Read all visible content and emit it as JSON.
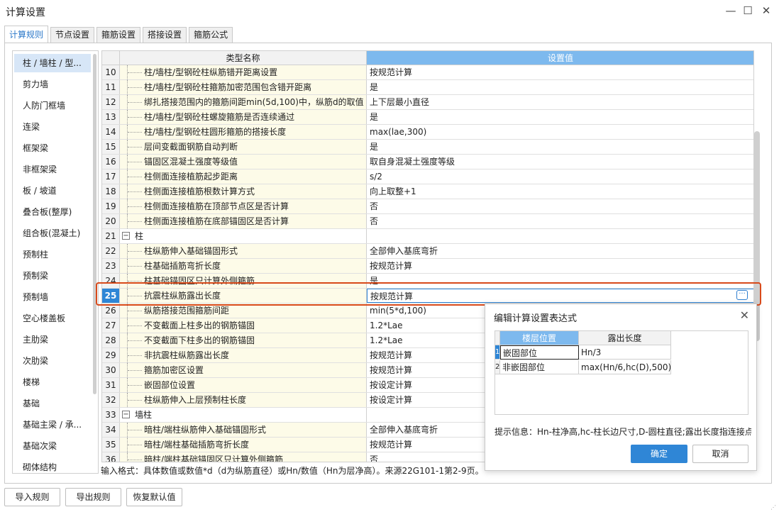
{
  "window": {
    "title": "计算设置"
  },
  "tabs": [
    {
      "label": "计算规则",
      "active": true
    },
    {
      "label": "节点设置",
      "active": false
    },
    {
      "label": "箍筋设置",
      "active": false
    },
    {
      "label": "搭接设置",
      "active": false
    },
    {
      "label": "箍筋公式",
      "active": false
    }
  ],
  "sidebar": {
    "items": [
      "柱 / 墙柱 / 型...",
      "剪力墙",
      "人防门框墙",
      "连梁",
      "框架梁",
      "非框架梁",
      "板 / 坡道",
      "叠合板(整厚)",
      "组合板(混凝土)",
      "预制柱",
      "预制梁",
      "预制墙",
      "空心楼盖板",
      "主肋梁",
      "次肋梁",
      "楼梯",
      "基础",
      "基础主梁 / 承...",
      "基础次梁",
      "砌体结构"
    ],
    "selected_index": 0
  },
  "grid": {
    "columns": [
      "类型名称",
      "设置值"
    ],
    "rows": [
      {
        "no": "10",
        "name": "柱/墙柱/型钢砼柱纵筋错开距离设置",
        "value": "按规范计算"
      },
      {
        "no": "11",
        "name": "柱/墙柱/型钢砼柱箍筋加密范围包含错开距离",
        "value": "是"
      },
      {
        "no": "12",
        "name": "绑扎搭接范围内的箍筋间距min(5d,100)中，纵筋d的取值",
        "value": "上下层最小直径"
      },
      {
        "no": "13",
        "name": "柱/墙柱/型钢砼柱螺旋箍筋是否连续通过",
        "value": "是"
      },
      {
        "no": "14",
        "name": "柱/墙柱/型钢砼柱圆形箍筋的搭接长度",
        "value": "max(lae,300)"
      },
      {
        "no": "15",
        "name": "层间变截面钢筋自动判断",
        "value": "是"
      },
      {
        "no": "16",
        "name": "锚固区混凝土强度等级值",
        "value": "取自身混凝土强度等级"
      },
      {
        "no": "17",
        "name": "柱侧面连接植筋起步距离",
        "value": "s/2"
      },
      {
        "no": "18",
        "name": "柱侧面连接植筋根数计算方式",
        "value": "向上取整+1"
      },
      {
        "no": "19",
        "name": "柱侧面连接植筋在顶部节点区是否计算",
        "value": "否"
      },
      {
        "no": "20",
        "name": "柱侧面连接植筋在底部锚固区是否计算",
        "value": "否"
      },
      {
        "no": "21",
        "name": "柱",
        "value": "",
        "group": true
      },
      {
        "no": "22",
        "name": "柱纵筋伸入基础锚固形式",
        "value": "全部伸入基底弯折"
      },
      {
        "no": "23",
        "name": "柱基础插筋弯折长度",
        "value": "按规范计算"
      },
      {
        "no": "24",
        "name": "柱基础锚固区只计算外侧箍筋",
        "value": "是"
      },
      {
        "no": "25",
        "name": "抗震柱纵筋露出长度",
        "value": "按规范计算",
        "selected": true
      },
      {
        "no": "26",
        "name": "纵筋搭接范围箍筋间距",
        "value": "min(5*d,100)"
      },
      {
        "no": "27",
        "name": "不变截面上柱多出的钢筋锚固",
        "value": "1.2*Lae"
      },
      {
        "no": "28",
        "name": "不变截面下柱多出的钢筋锚固",
        "value": "1.2*Lae"
      },
      {
        "no": "29",
        "name": "非抗震柱纵筋露出长度",
        "value": "按规范计算"
      },
      {
        "no": "30",
        "name": "箍筋加密区设置",
        "value": "按规范计算"
      },
      {
        "no": "31",
        "name": "嵌固部位设置",
        "value": "按设定计算"
      },
      {
        "no": "32",
        "name": "柱纵筋伸入上层预制柱长度",
        "value": "按设定计算"
      },
      {
        "no": "33",
        "name": "墙柱",
        "value": "",
        "group": true
      },
      {
        "no": "34",
        "name": "暗柱/端柱纵筋伸入基础锚固形式",
        "value": "全部伸入基底弯折"
      },
      {
        "no": "35",
        "name": "暗柱/端柱基础插筋弯折长度",
        "value": "按规范计算"
      },
      {
        "no": "36",
        "name": "暗柱/端柱基础锚固区只计算外侧箍筋",
        "value": "否"
      }
    ]
  },
  "hint": "输入格式：具体数值或数值*d（d为纵筋直径）或Hn/数值（Hn为层净高）。来源22G101-1第2-9页。",
  "dialog": {
    "title": "编辑计算设置表达式",
    "columns": [
      "楼层位置",
      "露出长度"
    ],
    "rows": [
      {
        "no": "1",
        "position": "嵌固部位",
        "length": "Hn/3"
      },
      {
        "no": "2",
        "position": "非嵌固部位",
        "length": "max(Hn/6,hc(D),500)"
      }
    ],
    "info": "提示信息：Hn-柱净高,hc-柱长边尺寸,D-圆柱直径;露出长度指连接点",
    "ok_label": "确定",
    "cancel_label": "取消"
  },
  "footer": {
    "import_label": "导入规则",
    "export_label": "导出规则",
    "reset_label": "恢复默认值"
  },
  "colors": {
    "accent": "#2f86d6",
    "highlight": "#d84a1b",
    "name_bg": "#fdfbe8"
  }
}
